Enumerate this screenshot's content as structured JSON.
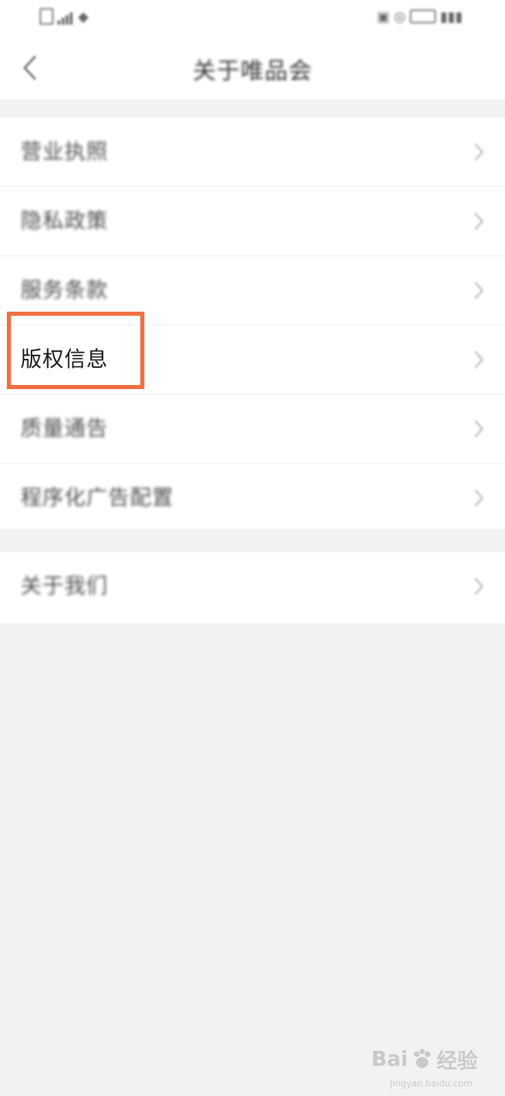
{
  "status_bar": {
    "left_text": "",
    "right_text": ""
  },
  "header": {
    "title": "关于唯品会"
  },
  "menu_group_1": {
    "items": [
      {
        "label": "营业执照"
      },
      {
        "label": "隐私政策"
      },
      {
        "label": "服务条款"
      },
      {
        "label": "版权信息"
      },
      {
        "label": "质量通告"
      },
      {
        "label": "程序化广告配置"
      }
    ]
  },
  "menu_group_2": {
    "items": [
      {
        "label": "关于我们"
      }
    ]
  },
  "annotation": {
    "highlight_color": "#f07042"
  },
  "watermark": {
    "brand": "Bai",
    "brand_suffix": "经验",
    "url": "jingyan.baidu.com"
  },
  "colors": {
    "background": "#f2f2f3",
    "card": "#ffffff",
    "text": "#222222"
  }
}
